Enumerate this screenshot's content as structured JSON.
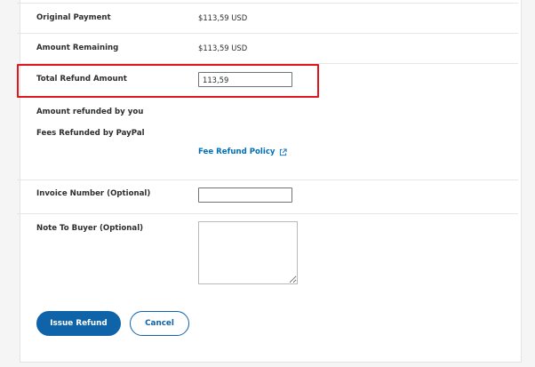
{
  "payment": {
    "original_label": "Original Payment",
    "original_value": "$113,59 USD",
    "remaining_label": "Amount Remaining",
    "remaining_value": "$113,59 USD"
  },
  "refund": {
    "total_label": "Total Refund Amount",
    "total_value": "113,59",
    "refunded_by_you_label": "Amount refunded by you",
    "fees_refunded_label": "Fees Refunded by PayPal",
    "fee_policy_link": "Fee Refund Policy"
  },
  "invoice": {
    "label": "Invoice Number (Optional)",
    "value": ""
  },
  "note": {
    "label": "Note To Buyer (Optional)",
    "value": ""
  },
  "actions": {
    "issue_label": "Issue Refund",
    "cancel_label": "Cancel"
  },
  "icons": {
    "external_link": "external-link-icon"
  },
  "colors": {
    "accent": "#0f63a8",
    "link": "#0070ba",
    "highlight": "#e0161d"
  }
}
